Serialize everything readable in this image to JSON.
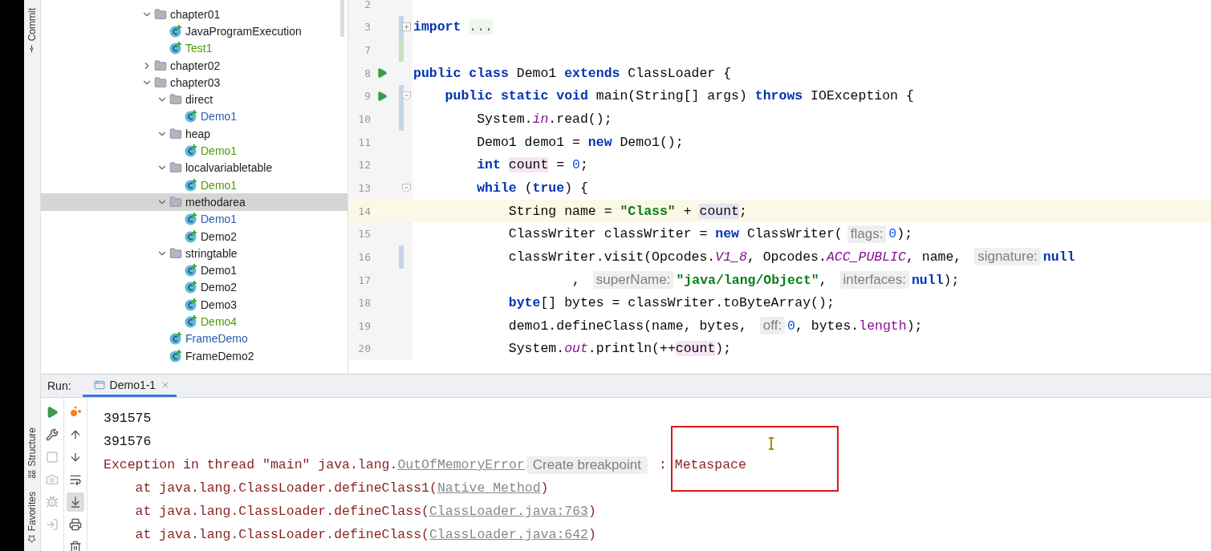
{
  "side_tabs_top": [
    {
      "label": "Commit",
      "kind": "commit"
    }
  ],
  "side_tabs_bottom": [
    {
      "label": "Structure",
      "kind": "structure"
    },
    {
      "label": "Favorites",
      "kind": "favorites"
    }
  ],
  "project_tree": [
    {
      "label": "chapter01",
      "kind": "folder",
      "expanded": true,
      "selected": false,
      "children": [
        {
          "label": "JavaProgramExecution",
          "kind": "class",
          "selected": false
        },
        {
          "label": "Test1",
          "kind": "class",
          "color": "#4e9a06",
          "selected": false
        }
      ]
    },
    {
      "label": "chapter02",
      "kind": "folder",
      "expanded": false,
      "selected": false
    },
    {
      "label": "chapter03",
      "kind": "folder",
      "expanded": true,
      "selected": false,
      "children": [
        {
          "label": "direct",
          "kind": "folder",
          "expanded": true,
          "selected": false,
          "children": [
            {
              "label": "Demo1",
              "kind": "class",
              "color": "#2a5db0",
              "selected": false
            }
          ]
        },
        {
          "label": "heap",
          "kind": "folder",
          "expanded": true,
          "selected": false,
          "children": [
            {
              "label": "Demo1",
              "kind": "class",
              "color": "#4e9a06",
              "selected": false
            }
          ]
        },
        {
          "label": "localvariabletable",
          "kind": "folder",
          "expanded": true,
          "selected": false,
          "children": [
            {
              "label": "Demo1",
              "kind": "class",
              "color": "#4e9a06",
              "selected": false
            }
          ]
        },
        {
          "label": "methodarea",
          "kind": "folder",
          "expanded": true,
          "selected": true,
          "children": [
            {
              "label": "Demo1",
              "kind": "class",
              "color": "#2a5db0",
              "selected": false
            },
            {
              "label": "Demo2",
              "kind": "class",
              "selected": false
            }
          ]
        },
        {
          "label": "stringtable",
          "kind": "folder",
          "expanded": true,
          "selected": false,
          "children": [
            {
              "label": "Demo1",
              "kind": "class",
              "selected": false
            },
            {
              "label": "Demo2",
              "kind": "class",
              "selected": false
            },
            {
              "label": "Demo3",
              "kind": "class",
              "selected": false
            },
            {
              "label": "Demo4",
              "kind": "class",
              "color": "#4e9a06",
              "selected": false
            }
          ]
        },
        {
          "label": "FrameDemo",
          "kind": "class",
          "color": "#2a5db0",
          "selected": false
        },
        {
          "label": "FrameDemo2",
          "kind": "class",
          "selected": false
        }
      ]
    }
  ],
  "editor": {
    "lines": [
      {
        "number": "2",
        "current": false
      },
      {
        "number": "3",
        "current": false,
        "modified": true,
        "foldable": true,
        "folded": true,
        "tokens": [
          {
            "kind": "kw",
            "text": "import "
          },
          {
            "kind": "folded",
            "text": "..."
          }
        ]
      },
      {
        "number": "7",
        "current": false,
        "added": true
      },
      {
        "number": "8",
        "current": false,
        "run": true,
        "tokens": [
          {
            "kind": "kw",
            "text": "public class"
          },
          {
            "kind": "plain",
            "text": " Demo1 "
          },
          {
            "kind": "kw",
            "text": "extends"
          },
          {
            "kind": "plain",
            "text": " ClassLoader {"
          }
        ]
      },
      {
        "number": "9",
        "current": false,
        "run": true,
        "modified": true,
        "foldable": true,
        "folded": false,
        "tokens": [
          {
            "kind": "kw",
            "text": "    public static void"
          },
          {
            "kind": "plain",
            "text": " main(String[] args) "
          },
          {
            "kind": "kw",
            "text": "throws"
          },
          {
            "kind": "plain",
            "text": " IOException {"
          }
        ]
      },
      {
        "number": "10",
        "current": false,
        "modified": true,
        "tokens": [
          {
            "kind": "plain",
            "text": "        System."
          },
          {
            "kind": "static",
            "text": "in"
          },
          {
            "kind": "plain",
            "text": ".read();"
          }
        ]
      },
      {
        "number": "11",
        "current": false,
        "tokens": [
          {
            "kind": "plain",
            "text": "        Demo1 demo1 = "
          },
          {
            "kind": "kw",
            "text": "new"
          },
          {
            "kind": "plain",
            "text": " Demo1();"
          }
        ]
      },
      {
        "number": "12",
        "current": false,
        "tokens": [
          {
            "kind": "kw",
            "text": "        int "
          },
          {
            "kind": "var",
            "text": "count"
          },
          {
            "kind": "plain",
            "text": " = "
          },
          {
            "kind": "num",
            "text": "0"
          },
          {
            "kind": "plain",
            "text": ";"
          }
        ]
      },
      {
        "number": "13",
        "current": false,
        "foldable": true,
        "folded": false,
        "tokens": [
          {
            "kind": "kw",
            "text": "        while"
          },
          {
            "kind": "plain",
            "text": " ("
          },
          {
            "kind": "kw",
            "text": "true"
          },
          {
            "kind": "plain",
            "text": ") {"
          }
        ]
      },
      {
        "number": "14",
        "current": true,
        "tokens": [
          {
            "kind": "plain",
            "text": "            String name = "
          },
          {
            "kind": "str",
            "text": "\"Class\""
          },
          {
            "kind": "plain",
            "text": " + "
          },
          {
            "kind": "caret_var",
            "text": "count"
          },
          {
            "kind": "plain",
            "text": ";"
          }
        ]
      },
      {
        "number": "15",
        "current": false,
        "tokens": [
          {
            "kind": "plain",
            "text": "            ClassWriter classWriter = "
          },
          {
            "kind": "kw",
            "text": "new"
          },
          {
            "kind": "plain",
            "text": " ClassWriter("
          },
          {
            "kind": "hint",
            "text": "flags:"
          },
          {
            "kind": "num",
            "text": "0"
          },
          {
            "kind": "plain",
            "text": ");"
          }
        ]
      },
      {
        "number": "16",
        "current": false,
        "modified": true,
        "tokens": [
          {
            "kind": "plain",
            "text": "            classWriter.visit(Opcodes."
          },
          {
            "kind": "static",
            "text": "V1_8"
          },
          {
            "kind": "plain",
            "text": ", Opcodes."
          },
          {
            "kind": "static",
            "text": "ACC_PUBLIC"
          },
          {
            "kind": "plain",
            "text": ", name, "
          },
          {
            "kind": "hint",
            "text": "signature:"
          },
          {
            "kind": "kw",
            "text": "null"
          }
        ]
      },
      {
        "number": "17",
        "current": false,
        "tokens": [
          {
            "kind": "plain",
            "text": "                    , "
          },
          {
            "kind": "hint",
            "text": "superName:"
          },
          {
            "kind": "str",
            "text": "\"java/lang/Object\""
          },
          {
            "kind": "plain",
            "text": ", "
          },
          {
            "kind": "hint",
            "text": "interfaces:"
          },
          {
            "kind": "kw",
            "text": "null"
          },
          {
            "kind": "plain",
            "text": ");"
          }
        ]
      },
      {
        "number": "18",
        "current": false,
        "tokens": [
          {
            "kind": "kw",
            "text": "            byte"
          },
          {
            "kind": "plain",
            "text": "[] bytes = classWriter.toByteArray();"
          }
        ]
      },
      {
        "number": "19",
        "current": false,
        "tokens": [
          {
            "kind": "plain",
            "text": "            demo1.defineClass(name, bytes, "
          },
          {
            "kind": "hint",
            "text": "off:"
          },
          {
            "kind": "num",
            "text": "0"
          },
          {
            "kind": "plain",
            "text": ", bytes."
          },
          {
            "kind": "field",
            "text": "length"
          },
          {
            "kind": "plain",
            "text": ");"
          }
        ]
      },
      {
        "number": "20",
        "current": false,
        "tokens": [
          {
            "kind": "plain",
            "text": "            System."
          },
          {
            "kind": "static",
            "text": "out"
          },
          {
            "kind": "plain",
            "text": ".println(++"
          },
          {
            "kind": "var",
            "text": "count"
          },
          {
            "kind": "plain",
            "text": ");"
          }
        ]
      }
    ]
  },
  "run_panel": {
    "label": "Run:",
    "tabs": [
      {
        "label": "Demo1-1",
        "selected": true
      }
    ],
    "left_tools": [
      {
        "kind": "rerun",
        "disabled": false,
        "selected": false
      },
      {
        "kind": "settings",
        "disabled": false,
        "selected": false
      },
      {
        "kind": "stop",
        "disabled": true,
        "selected": false
      },
      {
        "kind": "dump",
        "disabled": true,
        "selected": false
      },
      {
        "kind": "debug",
        "disabled": true,
        "selected": false
      },
      {
        "kind": "exit",
        "disabled": true,
        "selected": false
      }
    ],
    "right_tools": [
      {
        "kind": "graph",
        "disabled": false,
        "selected": false
      },
      {
        "kind": "up",
        "disabled": false,
        "selected": false
      },
      {
        "kind": "down",
        "disabled": false,
        "selected": false
      },
      {
        "kind": "wrap",
        "disabled": false,
        "selected": false
      },
      {
        "kind": "scroll_end",
        "disabled": false,
        "selected": true
      },
      {
        "kind": "print",
        "disabled": false,
        "selected": false
      },
      {
        "kind": "trash",
        "disabled": false,
        "selected": false
      }
    ],
    "console": [
      {
        "tokens": [
          {
            "kind": "out",
            "text": "391575"
          }
        ]
      },
      {
        "tokens": [
          {
            "kind": "out",
            "text": "391576"
          }
        ]
      },
      {
        "tokens": [
          {
            "kind": "err",
            "text": "Exception in thread \"main\" java.lang."
          },
          {
            "kind": "link",
            "text": "OutOfMemoryError"
          },
          {
            "kind": "hint",
            "text": "Create breakpoint"
          },
          {
            "kind": "err",
            "text": ": Metaspace"
          }
        ]
      },
      {
        "tokens": [
          {
            "kind": "err",
            "text": "    at java.lang.ClassLoader.defineClass1("
          },
          {
            "kind": "link",
            "text": "Native Method"
          },
          {
            "kind": "err",
            "text": ")"
          }
        ]
      },
      {
        "tokens": [
          {
            "kind": "err",
            "text": "    at java.lang.ClassLoader.defineClass("
          },
          {
            "kind": "link",
            "text": "ClassLoader.java:763"
          },
          {
            "kind": "err",
            "text": ")"
          }
        ]
      },
      {
        "tokens": [
          {
            "kind": "err",
            "text": "    at java.lang.ClassLoader.defineClass("
          },
          {
            "kind": "link",
            "text": "ClassLoader.java:642"
          },
          {
            "kind": "err",
            "text": ")"
          }
        ]
      }
    ]
  }
}
